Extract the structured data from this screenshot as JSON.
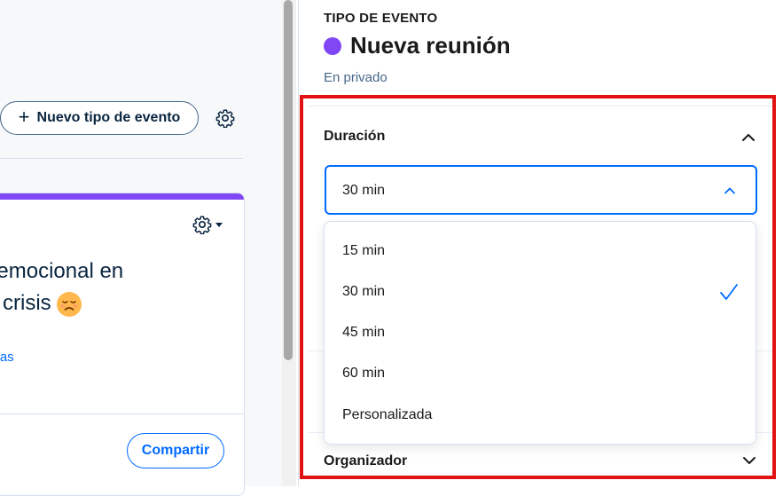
{
  "left": {
    "new_event_type_button": {
      "label": "Nuevo tipo de evento",
      "icon": "plus-icon"
    },
    "settings_icon": "gear-icon",
    "card": {
      "accent_color": "#8247f5",
      "title_line1": "ento emocional en",
      "title_line2": "e crisis",
      "emoji_icon": "disappointed-face-icon",
      "link_text": "ervas",
      "share_button": "Compartir"
    }
  },
  "panel": {
    "event_type_label": "TIPO DE EVENTO",
    "event_color": "#8247f5",
    "event_name": "Nueva reunión",
    "privacy": "En privado",
    "duration": {
      "label": "Duración",
      "selected": "30 min",
      "options": [
        "15 min",
        "30 min",
        "45 min",
        "60 min",
        "Personalizada"
      ],
      "checked_index": 1
    },
    "organizer": {
      "label": "Organizador"
    }
  },
  "colors": {
    "primary": "#006bff",
    "text": "#1a1a1a",
    "highlight": "#e21212"
  }
}
